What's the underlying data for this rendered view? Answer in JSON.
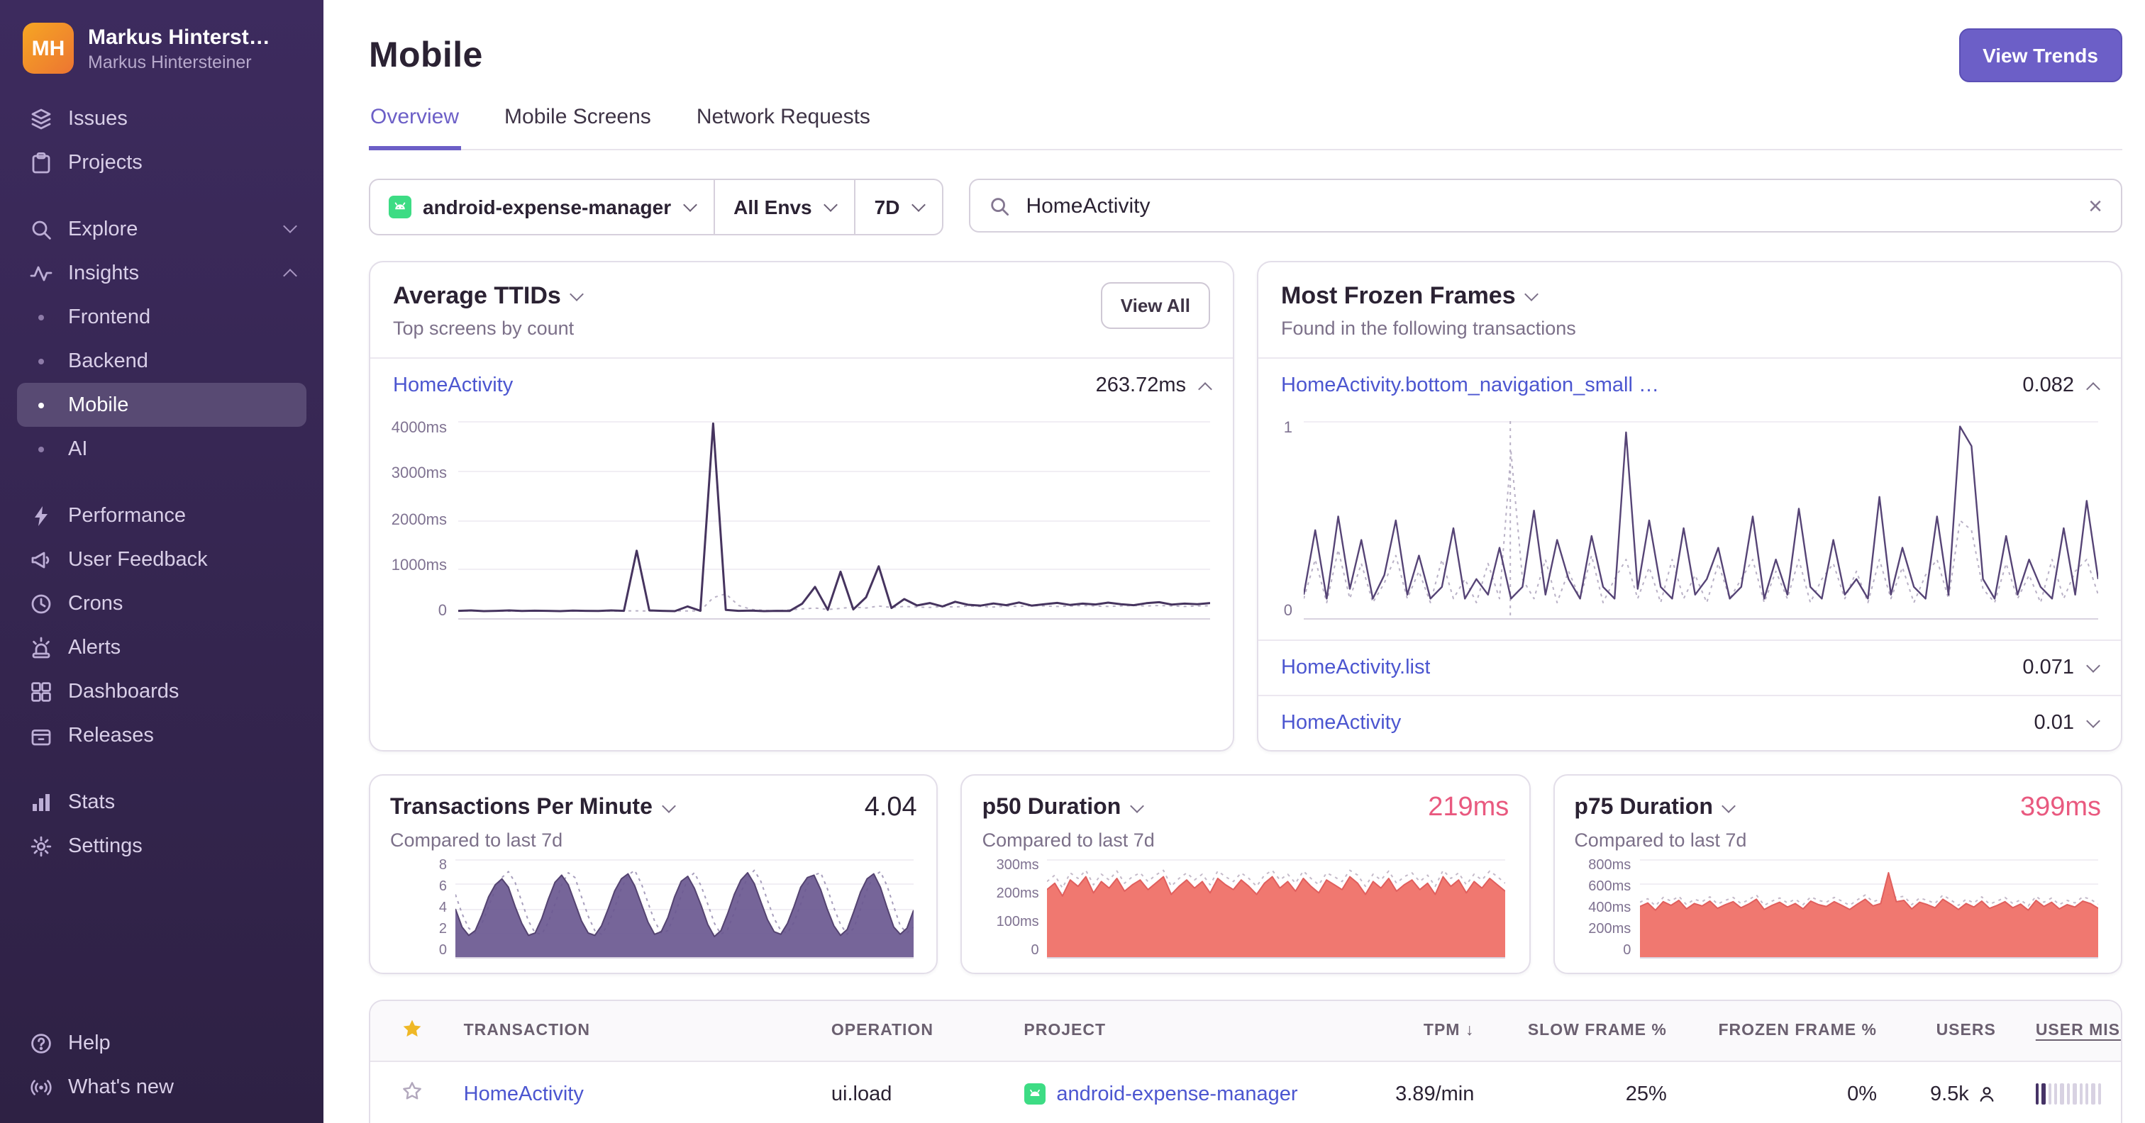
{
  "theme": {
    "accent": "#6c5fc7",
    "link": "#4c56d0",
    "danger": "#e9597f",
    "sidebar_top": "#3d2b5e",
    "sidebar_bottom": "#2e2144",
    "android_green": "#3ddc84",
    "star_gold": "#efb826"
  },
  "sidebar": {
    "user": {
      "initials": "MH",
      "name": "Markus Hinterst…",
      "org": "Markus Hintersteiner"
    },
    "primary": [
      {
        "label": "Issues"
      },
      {
        "label": "Projects"
      }
    ],
    "explore": {
      "label": "Explore"
    },
    "insights": {
      "label": "Insights",
      "children": [
        {
          "label": "Frontend"
        },
        {
          "label": "Backend"
        },
        {
          "label": "Mobile",
          "active": true
        },
        {
          "label": "AI"
        }
      ]
    },
    "tools": [
      "Performance",
      "User Feedback",
      "Crons",
      "Alerts",
      "Dashboards",
      "Releases"
    ],
    "secondary": [
      "Stats",
      "Settings"
    ],
    "footer": [
      "Help",
      "What's new"
    ]
  },
  "header": {
    "title": "Mobile",
    "view_trends": "View Trends"
  },
  "tabs": [
    {
      "label": "Overview"
    },
    {
      "label": "Mobile Screens"
    },
    {
      "label": "Network Requests"
    }
  ],
  "filters": {
    "project": "android-expense-manager",
    "env": "All Envs",
    "period": "7D",
    "search": "HomeActivity"
  },
  "cards": {
    "avg_ttids": {
      "title": "Average TTIDs",
      "subtitle": "Top screens by count",
      "action": "View All",
      "row": {
        "label": "HomeActivity",
        "value": "263.72ms"
      },
      "chart": {
        "ylim": [
          0,
          4000
        ],
        "yticks": [
          "4000ms",
          "3000ms",
          "2000ms",
          "1000ms",
          "0"
        ],
        "series": [
          {
            "name": "previous period",
            "color": "#b9b1c6",
            "dash": true,
            "width": 1,
            "values": [
              150,
              148,
              152,
              150,
              146,
              150,
              154,
              148,
              150,
              152,
              148,
              150,
              146,
              152,
              150,
              148,
              154,
              150,
              148,
              152,
              420,
              500,
              260,
              180,
              160,
              150,
              170,
              190,
              210,
              180,
              200,
              230,
              210,
              250,
              220,
              240,
              230,
              220,
              240,
              230,
              250,
              240,
              230,
              250,
              240,
              260,
              250,
              240,
              250,
              260,
              250,
              240,
              250,
              260,
              250,
              260,
              250,
              240,
              250,
              255
            ]
          },
          {
            "name": "current",
            "color": "#46345f",
            "width": 1.5,
            "values": [
              150,
              158,
              146,
              152,
              160,
              148,
              155,
              150,
              144,
              156,
              150,
              148,
              160,
              152,
              1380,
              160,
              150,
              146,
              240,
              152,
              3980,
              170,
              150,
              156,
              146,
              152,
              148,
              300,
              640,
              170,
              950,
              180,
              430,
              1060,
              210,
              390,
              260,
              310,
              240,
              335,
              275,
              258,
              302,
              268,
              322,
              258,
              288,
              312,
              272,
              298,
              282,
              318,
              288,
              268,
              308,
              328,
              278,
              298,
              288,
              310
            ]
          }
        ]
      }
    },
    "frozen": {
      "title": "Most Frozen Frames",
      "subtitle": "Found in the following transactions",
      "rows": [
        {
          "label": "HomeActivity.bottom_navigation_small …",
          "value": "0.082"
        },
        {
          "label": "HomeActivity.list",
          "value": "0.071"
        },
        {
          "label": "HomeActivity",
          "value": "0.01"
        }
      ],
      "chart": {
        "ylim": [
          0,
          1
        ],
        "yticks": [
          "1",
          "0"
        ],
        "vline": 0.26,
        "series": [
          {
            "name": "previous period",
            "color": "#b9b1c6",
            "dash": true,
            "width": 1,
            "values": [
              0.1,
              0.3,
              0.08,
              0.35,
              0.1,
              0.28,
              0.08,
              0.18,
              0.32,
              0.1,
              0.24,
              0.08,
              0.3,
              0.1,
              0.2,
              0.08,
              0.28,
              0.1,
              0.85,
              0.2,
              0.1,
              0.3,
              0.08,
              0.24,
              0.1,
              0.32,
              0.08,
              0.2,
              0.3,
              0.1,
              0.26,
              0.08,
              0.3,
              0.1,
              0.22,
              0.08,
              0.28,
              0.1,
              0.2,
              0.3,
              0.08,
              0.24,
              0.1,
              0.3,
              0.08,
              0.2,
              0.28,
              0.1,
              0.24,
              0.08,
              0.3,
              0.1,
              0.26,
              0.08,
              0.22,
              0.3,
              0.1,
              0.5,
              0.45,
              0.15,
              0.08,
              0.28,
              0.1,
              0.22,
              0.08,
              0.3,
              0.1,
              0.24,
              0.3,
              0.12
            ]
          },
          {
            "name": "current",
            "color": "#564476",
            "width": 1.2,
            "values": [
              0.12,
              0.45,
              0.1,
              0.52,
              0.15,
              0.4,
              0.1,
              0.22,
              0.5,
              0.12,
              0.32,
              0.1,
              0.16,
              0.46,
              0.1,
              0.2,
              0.12,
              0.36,
              0.1,
              0.16,
              0.55,
              0.12,
              0.4,
              0.2,
              0.1,
              0.42,
              0.16,
              0.1,
              0.95,
              0.15,
              0.5,
              0.16,
              0.1,
              0.46,
              0.12,
              0.2,
              0.36,
              0.1,
              0.16,
              0.52,
              0.1,
              0.3,
              0.12,
              0.56,
              0.16,
              0.1,
              0.4,
              0.12,
              0.2,
              0.1,
              0.62,
              0.12,
              0.36,
              0.16,
              0.1,
              0.52,
              0.12,
              0.98,
              0.88,
              0.2,
              0.1,
              0.42,
              0.12,
              0.3,
              0.16,
              0.1,
              0.46,
              0.12,
              0.6,
              0.2
            ]
          }
        ]
      }
    },
    "stats": [
      {
        "title": "Transactions Per Minute",
        "value": "4.04",
        "value_color": "#2b2233",
        "subtitle": "Compared to last 7d",
        "chart": {
          "ylim": [
            0,
            8
          ],
          "yticks": [
            "8",
            "6",
            "4",
            "2",
            "0"
          ],
          "series": [
            {
              "name": "previous period",
              "color": "#a79ebc",
              "dash": true,
              "width": 1,
              "values": [
                5.2,
                3.6,
                2.4,
                2.0,
                2.8,
                4.2,
                5.6,
                6.6,
                7.1,
                6.2,
                4.6,
                3.0,
                2.0,
                1.9,
                2.9,
                4.4,
                6.0,
                7.0,
                6.6,
                5.0,
                3.4,
                2.2,
                1.9,
                2.7,
                4.1,
                5.7,
                6.8,
                7.2,
                6.1,
                4.5,
                3.0,
                2.0,
                2.2,
                3.5,
                5.1,
                6.5,
                7.0,
                5.9,
                4.4,
                2.8,
                1.9,
                2.3,
                3.7,
                5.4,
                6.6,
                7.2,
                6.3,
                4.7,
                3.2,
                2.2,
                2.0,
                2.9,
                4.4,
                6.0,
                6.8,
                7.0,
                5.7,
                4.1,
                2.7,
                1.9,
                2.4,
                4.0,
                5.6,
                6.7,
                7.1,
                5.9,
                4.2,
                2.6,
                2.0,
                2.5
              ]
            },
            {
              "name": "current",
              "color": "#6a5890",
              "area": true,
              "opacity": 0.92,
              "stroke": "#544371",
              "width": 1,
              "values": [
                4.0,
                2.5,
                1.8,
                2.2,
                3.5,
                5.0,
                6.0,
                6.5,
                5.8,
                4.2,
                2.8,
                1.8,
                2.0,
                3.2,
                4.8,
                6.2,
                6.8,
                6.0,
                4.5,
                3.0,
                2.0,
                1.8,
                2.6,
                4.0,
                5.5,
                6.5,
                6.9,
                5.9,
                4.4,
                2.9,
                1.9,
                2.1,
                3.3,
                5.0,
                6.3,
                6.7,
                5.7,
                4.3,
                2.7,
                1.7,
                2.2,
                3.6,
                5.2,
                6.4,
                7.0,
                6.1,
                4.6,
                3.1,
                2.1,
                1.9,
                2.8,
                4.2,
                5.8,
                6.6,
                6.8,
                5.6,
                4.0,
                2.6,
                1.8,
                2.3,
                3.8,
                5.4,
                6.5,
                6.9,
                5.8,
                4.1,
                2.5,
                1.9,
                2.4,
                3.9
              ]
            }
          ]
        }
      },
      {
        "title": "p50 Duration",
        "value": "219ms",
        "value_color": "#e9597f",
        "subtitle": "Compared to last 7d",
        "chart": {
          "ylim": [
            0,
            300
          ],
          "yticks": [
            "300ms",
            "200ms",
            "100ms",
            "0"
          ],
          "series": [
            {
              "name": "previous period",
              "color": "#c4bac9",
              "dash": true,
              "width": 1,
              "values": [
                235,
                255,
                215,
                262,
                245,
                270,
                225,
                258,
                240,
                268,
                230,
                250,
                262,
                235,
                255,
                270,
                220,
                245,
                262,
                240,
                258,
                225,
                268,
                250,
                235,
                262,
                245,
                220,
                255,
                270,
                240,
                258,
                230,
                268,
                245,
                225,
                262,
                250,
                235,
                270,
                255,
                220,
                258,
                240,
                268,
                230,
                250,
                262,
                235,
                255,
                220,
                270,
                245,
                262,
                225,
                258,
                240,
                268,
                250,
                230
              ]
            },
            {
              "name": "current",
              "color": "#ef7168",
              "area": true,
              "opacity": 0.95,
              "stroke": "#e05f5d",
              "width": 1,
              "values": [
                210,
                230,
                190,
                240,
                220,
                250,
                200,
                235,
                215,
                245,
                205,
                225,
                240,
                210,
                230,
                250,
                195,
                220,
                240,
                215,
                235,
                200,
                245,
                225,
                210,
                240,
                220,
                195,
                230,
                250,
                215,
                235,
                205,
                245,
                220,
                200,
                240,
                225,
                210,
                250,
                230,
                195,
                235,
                215,
                245,
                205,
                225,
                240,
                210,
                230,
                195,
                250,
                220,
                240,
                200,
                235,
                215,
                245,
                225,
                205
              ]
            }
          ]
        }
      },
      {
        "title": "p75 Duration",
        "value": "399ms",
        "value_color": "#e9597f",
        "subtitle": "Compared to last 7d",
        "chart": {
          "ylim": [
            0,
            800
          ],
          "yticks": [
            "800ms",
            "600ms",
            "400ms",
            "200ms",
            "0"
          ],
          "series": [
            {
              "name": "previous period",
              "color": "#c4bac9",
              "dash": true,
              "width": 1,
              "values": [
                455,
                485,
                425,
                495,
                465,
                505,
                435,
                480,
                460,
                500,
                440,
                470,
                495,
                445,
                475,
                515,
                430,
                465,
                490,
                450,
                480,
                435,
                500,
                470,
                455,
                495,
                465,
                430,
                475,
                515,
                460,
                480,
                520,
                495,
                505,
                435,
                490,
                470,
                445,
                515,
                475,
                430,
                480,
                450,
                500,
                440,
                465,
                495,
                445,
                475,
                425,
                505,
                455,
                490,
                435,
                470,
                450,
                500,
                480,
                440
              ]
            },
            {
              "name": "current",
              "color": "#ef7168",
              "area": true,
              "opacity": 0.95,
              "stroke": "#e05f5d",
              "width": 1,
              "values": [
                420,
                450,
                390,
                460,
                430,
                470,
                400,
                445,
                425,
                465,
                405,
                435,
                460,
                410,
                440,
                480,
                395,
                430,
                455,
                415,
                445,
                400,
                465,
                435,
                420,
                460,
                430,
                395,
                440,
                480,
                425,
                445,
                700,
                460,
                470,
                400,
                455,
                435,
                410,
                480,
                440,
                395,
                445,
                415,
                465,
                405,
                430,
                460,
                410,
                440,
                390,
                470,
                420,
                455,
                400,
                435,
                415,
                465,
                445,
                405
              ]
            }
          ]
        }
      }
    ]
  },
  "table": {
    "columns": [
      "TRANSACTION",
      "OPERATION",
      "PROJECT",
      "TPM",
      "SLOW FRAME %",
      "FROZEN FRAME %",
      "USERS",
      "USER MISERY"
    ],
    "sort_arrow": "↓",
    "rows": [
      {
        "transaction": "HomeActivity",
        "operation": "ui.load",
        "project": "android-expense-manager",
        "tpm": "3.89/min",
        "slow": "25%",
        "frozen": "0%",
        "users": "9.5k",
        "misery": [
          1,
          1,
          0,
          0,
          0,
          0,
          0,
          0,
          0,
          0,
          0
        ]
      }
    ]
  }
}
